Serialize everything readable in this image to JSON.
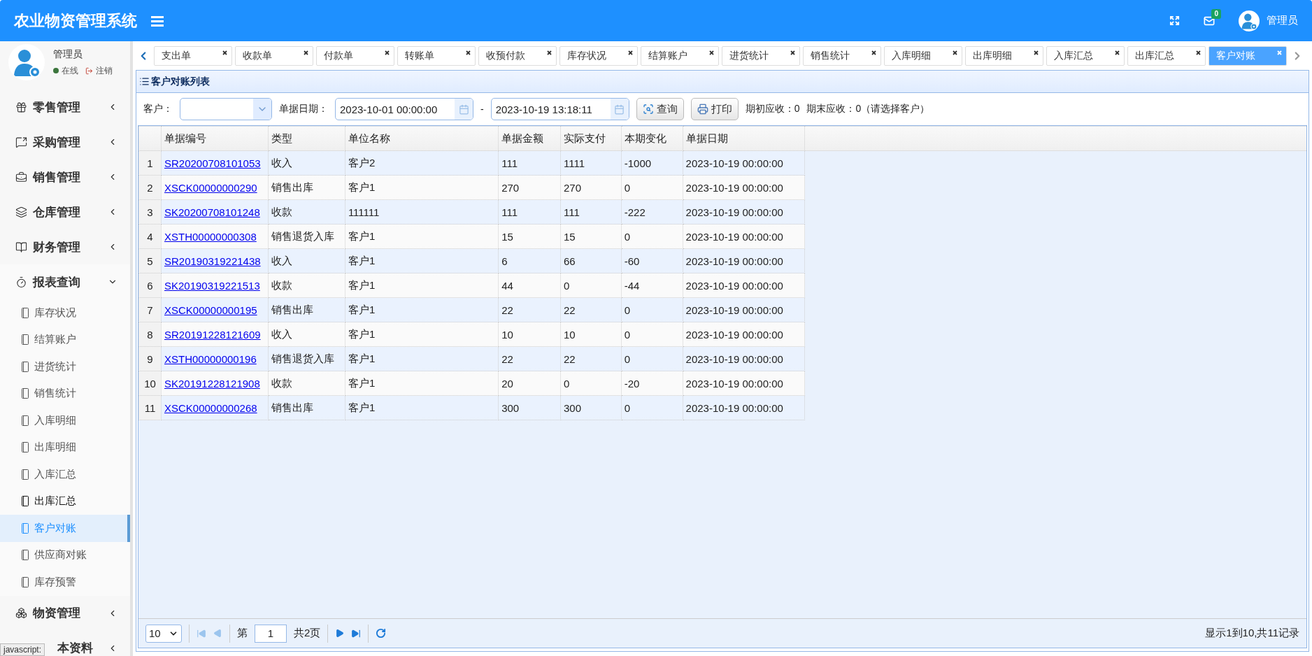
{
  "header": {
    "title": "农业物资管理系统",
    "notification_count": "0",
    "user_name": "管理员"
  },
  "sidebar": {
    "user": {
      "name": "管理员",
      "status": "在线",
      "logout": "注销"
    },
    "menu": [
      {
        "label": "零售管理",
        "expanded": false
      },
      {
        "label": "采购管理",
        "expanded": false
      },
      {
        "label": "销售管理",
        "expanded": false
      },
      {
        "label": "仓库管理",
        "expanded": false
      },
      {
        "label": "财务管理",
        "expanded": false
      },
      {
        "label": "报表查询",
        "expanded": true,
        "children": [
          {
            "label": "库存状况",
            "selected": false,
            "hovered": false
          },
          {
            "label": "结算账户",
            "selected": false,
            "hovered": false
          },
          {
            "label": "进货统计",
            "selected": false,
            "hovered": false
          },
          {
            "label": "销售统计",
            "selected": false,
            "hovered": false
          },
          {
            "label": "入库明细",
            "selected": false,
            "hovered": false
          },
          {
            "label": "出库明细",
            "selected": false,
            "hovered": false
          },
          {
            "label": "入库汇总",
            "selected": false,
            "hovered": false
          },
          {
            "label": "出库汇总",
            "selected": false,
            "hovered": true
          },
          {
            "label": "客户对账",
            "selected": true,
            "hovered": false
          },
          {
            "label": "供应商对账",
            "selected": false,
            "hovered": false
          },
          {
            "label": "库存预警",
            "selected": false,
            "hovered": false
          }
        ]
      },
      {
        "label": "物资管理",
        "expanded": false
      },
      {
        "label": "本资料",
        "expanded": false
      }
    ]
  },
  "tabs": [
    {
      "label": "支出单",
      "selected": false
    },
    {
      "label": "收款单",
      "selected": false
    },
    {
      "label": "付款单",
      "selected": false
    },
    {
      "label": "转账单",
      "selected": false
    },
    {
      "label": "收预付款",
      "selected": false
    },
    {
      "label": "库存状况",
      "selected": false
    },
    {
      "label": "结算账户",
      "selected": false
    },
    {
      "label": "进货统计",
      "selected": false
    },
    {
      "label": "销售统计",
      "selected": false
    },
    {
      "label": "入库明细",
      "selected": false
    },
    {
      "label": "出库明细",
      "selected": false
    },
    {
      "label": "入库汇总",
      "selected": false
    },
    {
      "label": "出库汇总",
      "selected": false
    },
    {
      "label": "客户对账",
      "selected": true
    }
  ],
  "panel": {
    "title": "客户对账列表"
  },
  "filters": {
    "customer_label": "客户：",
    "date_label": "单据日期：",
    "date_from": "2023-10-01 00:00:00",
    "separator": "-",
    "date_to": "2023-10-19 13:18:11",
    "query_button": "查询",
    "print_button": "打印",
    "opening": "期初应收：0",
    "closing": "期末应收：0（请选择客户）"
  },
  "table": {
    "columns": [
      "",
      "单据编号",
      "类型",
      "单位名称",
      "单据金额",
      "实际支付",
      "本期变化",
      "单据日期"
    ],
    "rows": [
      [
        "1",
        "SR20200708101053",
        "收入",
        "客户2",
        "111",
        "1111",
        "-1000",
        "2023-10-19 00:00:00"
      ],
      [
        "2",
        "XSCK00000000290",
        "销售出库",
        "客户1",
        "270",
        "270",
        "0",
        "2023-10-19 00:00:00"
      ],
      [
        "3",
        "SK20200708101248",
        "收款",
        "111111",
        "111",
        "111",
        "-222",
        "2023-10-19 00:00:00"
      ],
      [
        "4",
        "XSTH00000000308",
        "销售退货入库",
        "客户1",
        "15",
        "15",
        "0",
        "2023-10-19 00:00:00"
      ],
      [
        "5",
        "SR20190319221438",
        "收入",
        "客户1",
        "6",
        "66",
        "-60",
        "2023-10-19 00:00:00"
      ],
      [
        "6",
        "SK20190319221513",
        "收款",
        "客户1",
        "44",
        "0",
        "-44",
        "2023-10-19 00:00:00"
      ],
      [
        "7",
        "XSCK00000000195",
        "销售出库",
        "客户1",
        "22",
        "22",
        "0",
        "2023-10-19 00:00:00"
      ],
      [
        "8",
        "SR20191228121609",
        "收入",
        "客户1",
        "10",
        "10",
        "0",
        "2023-10-19 00:00:00"
      ],
      [
        "9",
        "XSTH00000000196",
        "销售退货入库",
        "客户1",
        "22",
        "22",
        "0",
        "2023-10-19 00:00:00"
      ],
      [
        "10",
        "SK20191228121908",
        "收款",
        "客户1",
        "20",
        "0",
        "-20",
        "2023-10-19 00:00:00"
      ],
      [
        "11",
        "XSCK00000000268",
        "销售出库",
        "客户1",
        "300",
        "300",
        "0",
        "2023-10-19 00:00:00"
      ]
    ]
  },
  "pagination": {
    "page_size": "10",
    "page_prefix": "第",
    "page": "1",
    "page_suffix": "共2页",
    "info": "显示1到10,共11记录"
  },
  "status_tooltip": "javascript:"
}
